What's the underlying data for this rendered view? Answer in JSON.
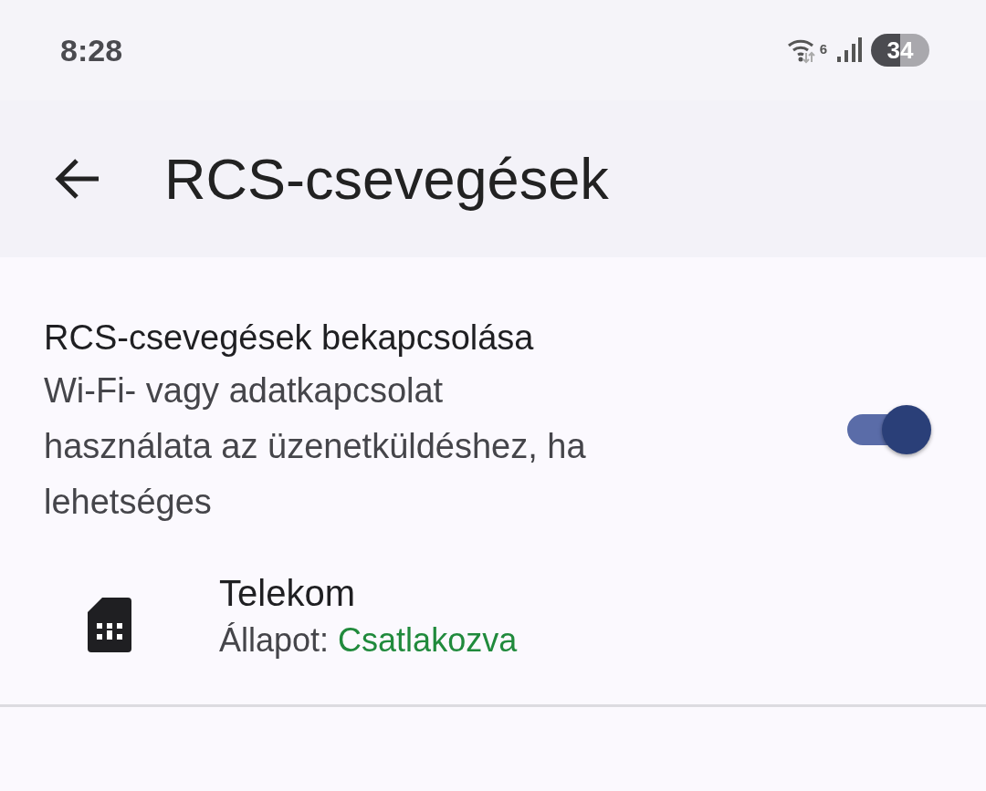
{
  "status_bar": {
    "time": "8:28",
    "wifi_badge": "6",
    "battery": "34"
  },
  "app_bar": {
    "title": "RCS-csevegések"
  },
  "rcs_setting": {
    "title": "RCS-csevegések bekapcsolása",
    "description": "Wi-Fi- vagy adatkapcsolat használata az üzenetküldéshez, ha lehetséges",
    "on": true
  },
  "sim": {
    "name": "Telekom",
    "status_label": "Állapot:",
    "status_value": "Csatlakozva"
  }
}
